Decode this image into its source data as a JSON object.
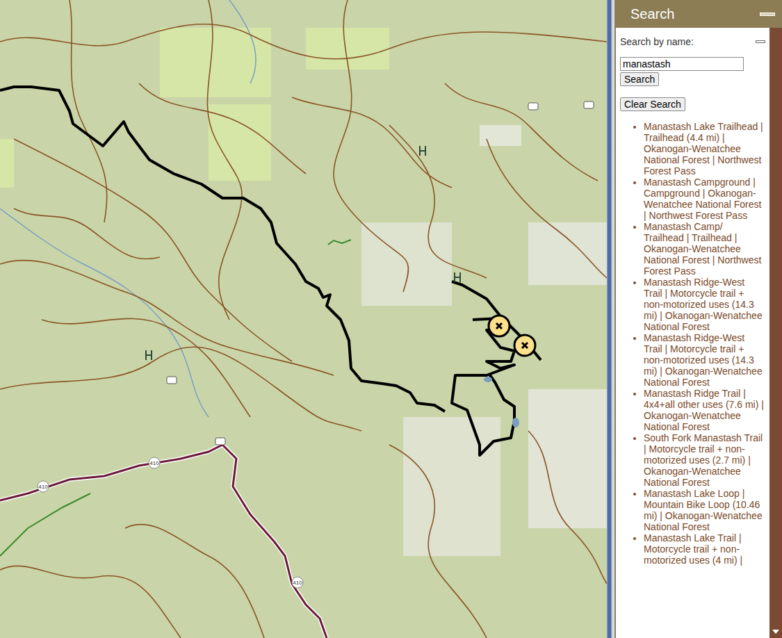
{
  "map": {
    "shields": [
      {
        "text": "410"
      },
      {
        "text": "410"
      },
      {
        "text": "410"
      }
    ],
    "markers": [
      {
        "selected": false
      },
      {
        "selected": false
      }
    ]
  },
  "panel": {
    "title": "Search",
    "collapsed": false
  },
  "search": {
    "label": "Search by name:",
    "value": "manastash",
    "search_button": "Search",
    "clear_button": "Clear Search"
  },
  "results": [
    {
      "text": "Manastash Lake Trailhead | Trailhead (4.4 mi) | Okanogan-Wenatchee National Forest | Northwest Forest Pass"
    },
    {
      "text": "Manastash Campground | Campground | Okanogan-Wenatchee National Forest | Northwest Forest Pass"
    },
    {
      "text": "Manastash Camp/ Trailhead | Trailhead | Okanogan-Wenatchee National Forest | Northwest Forest Pass"
    },
    {
      "text": "Manastash Ridge-West Trail | Motorcycle trail + non-motorized uses (14.3 mi) | Okanogan-Wenatchee National Forest"
    },
    {
      "text": "Manastash Ridge-West Trail | Motorcycle trail + non-motorized uses (14.3 mi) | Okanogan-Wenatchee National Forest"
    },
    {
      "text": "Manastash Ridge Trail | 4x4+all other uses (7.6 mi) | Okanogan-Wenatchee National Forest"
    },
    {
      "text": "South Fork Manastash Trail | Motorcycle trail + non-motorized uses (2.7 mi) | Okanogan-Wenatchee National Forest"
    },
    {
      "text": "Manastash Lake Loop | Mountain Bike Loop (10.46 mi) | Okanogan-Wenatchee National Forest"
    },
    {
      "text": "Manastash Lake Trail | Motorcycle trail + non-motorized uses (4 mi) |"
    }
  ]
}
